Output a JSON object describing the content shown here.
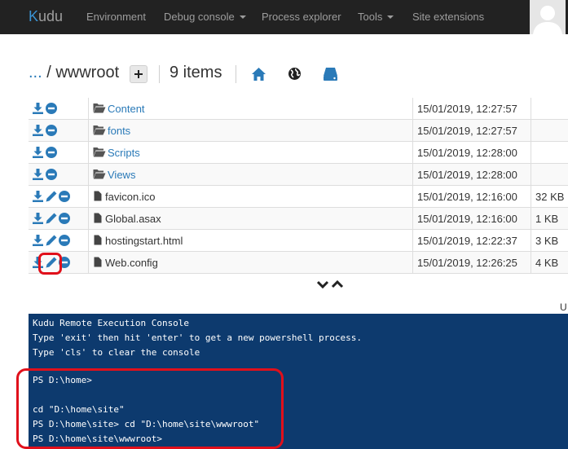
{
  "navbar": {
    "brand_k": "K",
    "brand_rest": "udu",
    "items": [
      {
        "label": "Environment",
        "dropdown": false
      },
      {
        "label": "Debug console",
        "dropdown": true
      },
      {
        "label": "Process explorer",
        "dropdown": false
      },
      {
        "label": "Tools",
        "dropdown": true
      },
      {
        "label": "Site extensions",
        "dropdown": false
      }
    ]
  },
  "header": {
    "ellipsis": "...",
    "path": " / wwwroot",
    "item_count": "9 items"
  },
  "files": [
    {
      "name": "Content",
      "type": "folder",
      "date": "15/01/2019, 12:27:57",
      "size": ""
    },
    {
      "name": "fonts",
      "type": "folder",
      "date": "15/01/2019, 12:27:57",
      "size": ""
    },
    {
      "name": "Scripts",
      "type": "folder",
      "date": "15/01/2019, 12:28:00",
      "size": ""
    },
    {
      "name": "Views",
      "type": "folder",
      "date": "15/01/2019, 12:28:00",
      "size": ""
    },
    {
      "name": "favicon.ico",
      "type": "file",
      "date": "15/01/2019, 12:16:00",
      "size": "32 KB"
    },
    {
      "name": "Global.asax",
      "type": "file",
      "date": "15/01/2019, 12:16:00",
      "size": "1 KB"
    },
    {
      "name": "hostingstart.html",
      "type": "file",
      "date": "15/01/2019, 12:22:37",
      "size": "3 KB"
    },
    {
      "name": "Web.config",
      "type": "file",
      "date": "15/01/2019, 12:26:25",
      "size": "4 KB"
    }
  ],
  "partial_text": "U",
  "console": {
    "lines": [
      "Kudu Remote Execution Console",
      "Type 'exit' then hit 'enter' to get a new powershell process.",
      "Type 'cls' to clear the console",
      "",
      "PS D:\\home>",
      "",
      "cd \"D:\\home\\site\"",
      "PS D:\\home\\site> cd \"D:\\home\\site\\wwwroot\"",
      "PS D:\\home\\site\\wwwroot>"
    ]
  },
  "colors": {
    "navbar_bg": "#222222",
    "link_blue": "#2a7ab8",
    "console_bg": "#0d3a6e",
    "highlight_red": "#e0101b"
  },
  "icons": [
    "download-icon",
    "edit-icon",
    "delete-icon",
    "folder-open-icon",
    "file-icon",
    "home-icon",
    "globe-icon",
    "drive-icon",
    "chevron-down-icon",
    "chevron-up-icon",
    "plus-icon"
  ]
}
